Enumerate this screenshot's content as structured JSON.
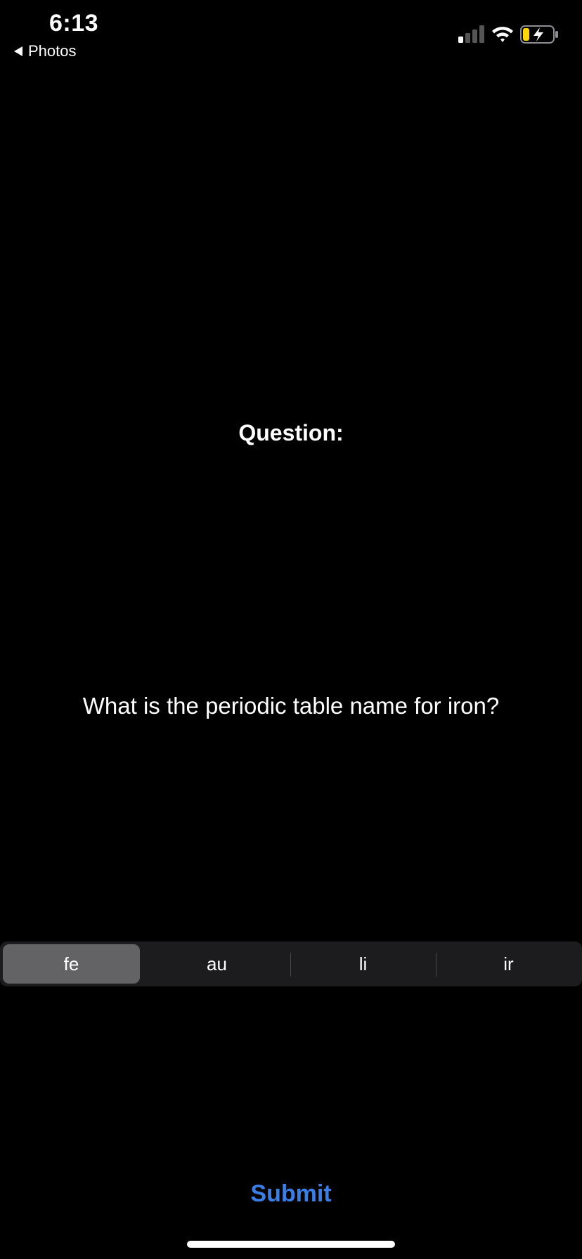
{
  "status_bar": {
    "time": "6:13",
    "back_label": "Photos",
    "icons": [
      "signal-icon",
      "wifi-icon",
      "battery-charging-icon"
    ],
    "battery_color": "#ffd60a"
  },
  "question": {
    "heading": "Question:",
    "text": "What is the periodic table name for iron?"
  },
  "options": {
    "selected": "fe",
    "items": [
      {
        "label": "fe"
      },
      {
        "label": "au"
      },
      {
        "label": "li"
      },
      {
        "label": "ir"
      }
    ]
  },
  "submit": {
    "label": "Submit",
    "color": "#3a7fe6"
  }
}
